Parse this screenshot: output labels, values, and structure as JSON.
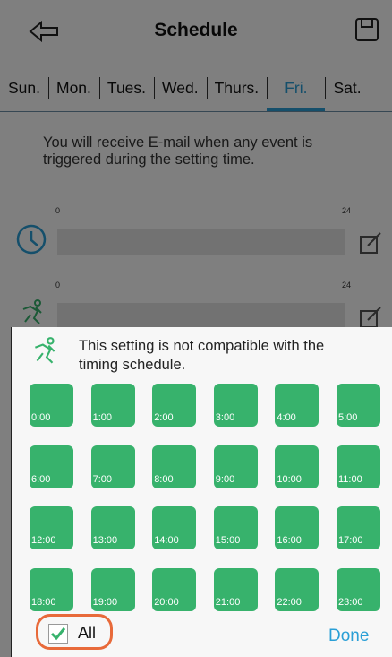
{
  "header": {
    "title": "Schedule"
  },
  "tabs": [
    "Sun.",
    "Mon.",
    "Tues.",
    "Wed.",
    "Thurs.",
    "Fri.",
    "Sat."
  ],
  "active_tab": "Fri.",
  "info": "You will receive E-mail when any event is triggered during the setting time.",
  "rows": [
    {
      "start": "0",
      "end": "24",
      "icon": "clock-icon"
    },
    {
      "start": "0",
      "end": "24",
      "icon": "motion-icon"
    }
  ],
  "sheet": {
    "message": "This setting is not compatible with the timing schedule.",
    "hours": [
      "0:00",
      "1:00",
      "2:00",
      "3:00",
      "4:00",
      "5:00",
      "6:00",
      "7:00",
      "8:00",
      "9:00",
      "10:00",
      "11:00",
      "12:00",
      "13:00",
      "14:00",
      "15:00",
      "16:00",
      "17:00",
      "18:00",
      "19:00",
      "20:00",
      "21:00",
      "22:00",
      "23:00"
    ],
    "all_label": "All",
    "all_checked": true,
    "done_label": "Done"
  },
  "colors": {
    "accent": "#2a9fd6",
    "cell": "#37b26c",
    "highlight": "#e86a3a"
  }
}
